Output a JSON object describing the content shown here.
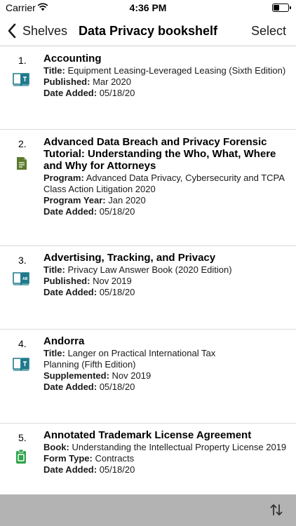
{
  "status": {
    "carrier": "Carrier",
    "time": "4:36 PM"
  },
  "nav": {
    "back_label": "Shelves",
    "title": "Data Privacy bookshelf",
    "select_label": "Select"
  },
  "items": [
    {
      "num": "1.",
      "icon": "book-t-icon",
      "title": "Accounting",
      "lines": [
        {
          "label": "Title:",
          "value": "Equipment Leasing-Leveraged Leasing (Sixth Edition)"
        },
        {
          "label": "Published:",
          "value": "Mar 2020"
        },
        {
          "label": "Date Added:",
          "value": "05/18/20"
        }
      ]
    },
    {
      "num": "2.",
      "icon": "document-icon",
      "title": "Advanced Data Breach and Privacy Forensic Tutorial: Understanding the Who, What, Where and Why for Attorneys",
      "lines": [
        {
          "label": "Program:",
          "value": "Advanced Data Privacy, Cybersecurity and TCPA Class Action Litigation 2020"
        },
        {
          "label": "Program Year:",
          "value": "Jan 2020"
        },
        {
          "label": "Date Added:",
          "value": "05/18/20"
        }
      ]
    },
    {
      "num": "3.",
      "icon": "book-ab-icon",
      "title": "Advertising, Tracking, and Privacy",
      "lines": [
        {
          "label": "Title:",
          "value": "Privacy Law Answer Book (2020 Edition)"
        },
        {
          "label": "Published:",
          "value": "Nov 2019"
        },
        {
          "label": "Date Added:",
          "value": "05/18/20"
        }
      ]
    },
    {
      "num": "4.",
      "icon": "book-t-icon",
      "title": "Andorra",
      "lines": [
        {
          "label": "Title:",
          "value": "Langer on Practical International Tax Planning (Fifth Edition)"
        },
        {
          "label": "Supplemented:",
          "value": "Nov 2019"
        },
        {
          "label": "Date Added:",
          "value": "05/18/20"
        }
      ]
    },
    {
      "num": "5.",
      "icon": "clipboard-icon",
      "title": "Annotated Trademark License Agreement",
      "lines": [
        {
          "label": "Book:",
          "value": "Understanding the Intellectual Property License 2019"
        },
        {
          "label": "Form Type:",
          "value": "Contracts"
        },
        {
          "label": "Date Added:",
          "value": "05/18/20"
        }
      ]
    }
  ],
  "colors": {
    "book_teal": "#1f7a8c",
    "doc_olive": "#5d7a2e",
    "form_green": "#2fa34b",
    "toolbar": "#b3b3b3"
  }
}
